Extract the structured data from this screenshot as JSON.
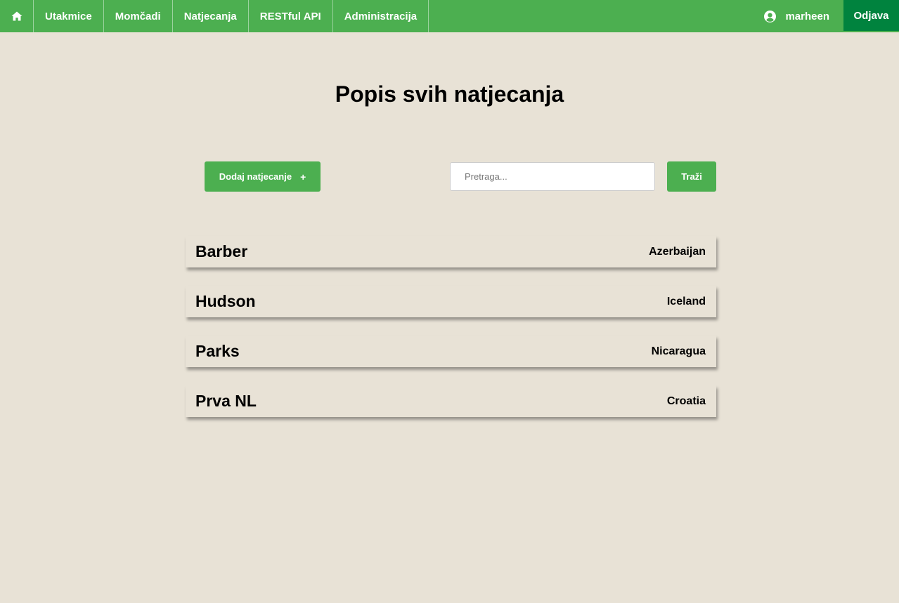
{
  "nav": {
    "home_icon": "home-icon",
    "links": [
      "Utakmice",
      "Momčadi",
      "Natjecanja",
      "RESTful API",
      "Administracija"
    ],
    "user_icon": "user-circle-icon",
    "username": "marheen",
    "logout_label": "Odjava",
    "color": "#4caf50",
    "logout_color": "#00833e"
  },
  "page": {
    "title": "Popis svih natjecanja",
    "background": "#e8e2d6"
  },
  "controls": {
    "add_label": "Dodaj natjecanje",
    "add_icon": "+",
    "search_placeholder": "Pretraga...",
    "search_value": "",
    "search_button_label": "Traži"
  },
  "competitions": [
    {
      "name": "Barber",
      "country": "Azerbaijan"
    },
    {
      "name": "Hudson",
      "country": "Iceland"
    },
    {
      "name": "Parks",
      "country": "Nicaragua"
    },
    {
      "name": "Prva NL",
      "country": "Croatia"
    }
  ]
}
